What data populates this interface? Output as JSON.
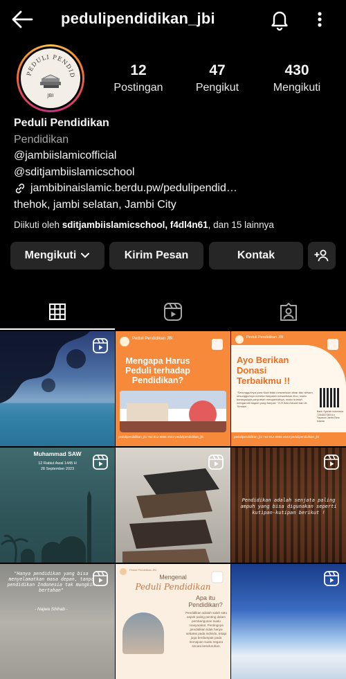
{
  "header": {
    "username": "pedulipendidikan_jbi",
    "back_icon": "arrow-left-icon",
    "notification_icon": "bell-icon",
    "menu_icon": "more-vertical-icon"
  },
  "avatar": {
    "arc_text": "PEDULI PENDIDIKAN",
    "bottom_text": "JBI"
  },
  "stats": [
    {
      "value": "12",
      "label": "Postingan"
    },
    {
      "value": "47",
      "label": "Pengikut"
    },
    {
      "value": "430",
      "label": "Mengikuti"
    }
  ],
  "bio": {
    "name": "Peduli Pendidikan",
    "category": "Pendidikan",
    "mention1": "@jambiislamicofficial",
    "mention2": "@sditjambiislamicschool",
    "link": "jambibinaislamic.berdu.pw/pedulipendid…",
    "location": "thehok, jambi selatan, Jambi City"
  },
  "followed_by": {
    "prefix": "Diikuti oleh ",
    "names": "sditjambiislamicschool, f4dl4n61",
    "suffix": ", dan 15 lainnya"
  },
  "actions": {
    "following": "Mengikuti",
    "message": "Kirim Pesan",
    "contact": "Kontak"
  },
  "tabs": [
    "posts-grid-icon",
    "reels-icon",
    "tagged-icon"
  ],
  "posts": {
    "p2": {
      "brand": "Peduli Pendidikan JBI",
      "title": "Mengapa Harus Peduli terhadap Pendidikan?",
      "footer": "pedulipendidikan_jbi   +62 812 6865 4643   pedulipendidikan_jbi"
    },
    "p3": {
      "brand": "Peduli Pendidikan JBI",
      "title": "Ayo Berikan Donasi Terbaikmu !!",
      "quote": "\"Sesungguhnya para Nabi tidak mewariskan dinar dan dirham, sesungguhnya mereka hanyalah mewariskan ilmu, maka barangsiapa yang telah mengambilnya, maka ia telah mengambil bagian yang banyak.\" H.R Abu Dawud dan At-Tirmidzi",
      "bank": "Bank Syariah Indonesia 7264837469 A.n Yayasan Jambi Bina Islamic",
      "footer": "pedulipendidikan_jbi   +62 812 6865 4643   pedulipendidikan_jbi"
    },
    "p4": {
      "title": "Muhammad SAW",
      "date1": "12 Rabiul Awal 1445 H",
      "date2": "28 September 2023"
    },
    "p6": {
      "quote": "Pendidikan adalah senjata paling ampuh yang bisa digunakan seperti kutipan-kutipan berikut !"
    },
    "p7": {
      "quote": "\"Hanya pendidikan yang bisa menyelamatkan masa depan, tanpa pendidikan Indonesia tak mungkin bertahan\"",
      "author": "- Najwa Shihab -"
    },
    "p8": {
      "brand": "Peduli Pendidikan JBI",
      "kicker": "Mengenal",
      "title": "Peduli Pendidikan",
      "question": "Apa itu Pendidikan?",
      "body": "Pendidikan adalah salah satu aspek paling penting dalam pembangunan suatu masyarakat. Pentingnya pendidikan tidak hanya sebatas pada individu, tetapi juga berdampak pada kemajuan suatu negara secara keseluruhan."
    }
  },
  "colors": {
    "background": "#000000",
    "button": "#262626",
    "orange_post": "#f7893a"
  }
}
